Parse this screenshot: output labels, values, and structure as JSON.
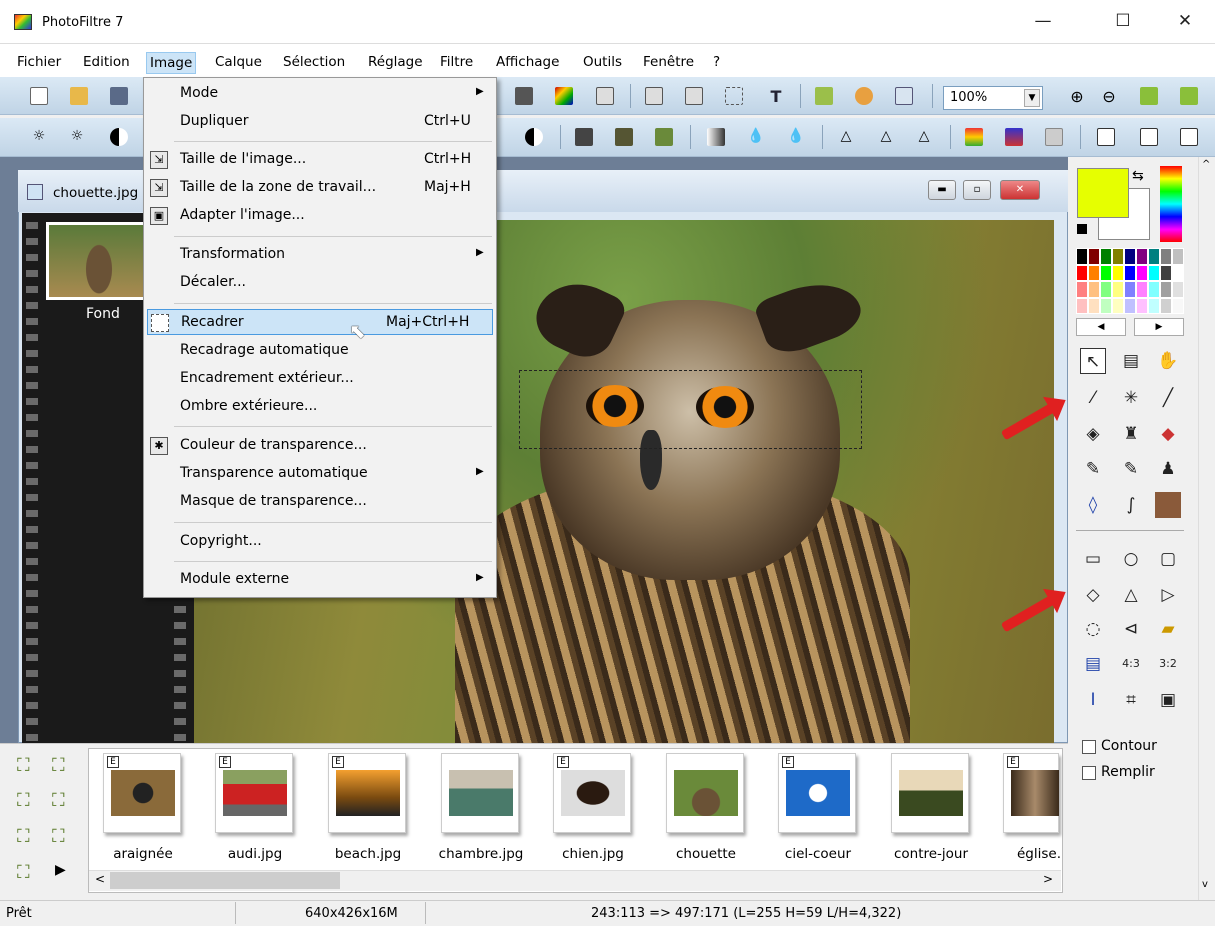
{
  "window": {
    "title": "PhotoFiltre 7"
  },
  "menubar": [
    "Fichier",
    "Edition",
    "Image",
    "Calque",
    "Sélection",
    "Réglage",
    "Filtre",
    "Affichage",
    "Outils",
    "Fenêtre",
    "?"
  ],
  "toolbar": {
    "zoom": "100%"
  },
  "document": {
    "title": "chouette.jpg",
    "layer": "Fond"
  },
  "image_menu": {
    "items": [
      {
        "label": "Mode",
        "submenu": true
      },
      {
        "label": "Dupliquer",
        "shortcut": "Ctrl+U"
      },
      {
        "label": "Taille de l'image...",
        "shortcut": "Ctrl+H"
      },
      {
        "label": "Taille de la zone de travail...",
        "shortcut": "Maj+H"
      },
      {
        "label": "Adapter l'image..."
      },
      {
        "label": "Transformation",
        "submenu": true
      },
      {
        "label": "Décaler..."
      },
      {
        "label": "Recadrer",
        "shortcut": "Maj+Ctrl+H"
      },
      {
        "label": "Recadrage automatique"
      },
      {
        "label": "Encadrement extérieur..."
      },
      {
        "label": "Ombre extérieure..."
      },
      {
        "label": "Couleur de transparence..."
      },
      {
        "label": "Transparence automatique",
        "submenu": true
      },
      {
        "label": "Masque de transparence..."
      },
      {
        "label": "Copyright..."
      },
      {
        "label": "Module externe",
        "submenu": true
      }
    ]
  },
  "options": {
    "contour": "Contour",
    "remplir": "Remplir"
  },
  "thumbnails": [
    "araignée",
    "audi.jpg",
    "beach.jpg",
    "chambre.jpg",
    "chien.jpg",
    "chouette",
    "ciel-coeur",
    "contre-jour",
    "église."
  ],
  "thumb_badge": "E",
  "status": {
    "state": "Prêt",
    "size": "640x426x16M",
    "selection": "243:113 => 497:171 (L=255  H=59  L/H=4,322)"
  },
  "colors": {
    "foreground": "#e6ff00",
    "background": "#ffffff",
    "accent": "#e02020"
  }
}
